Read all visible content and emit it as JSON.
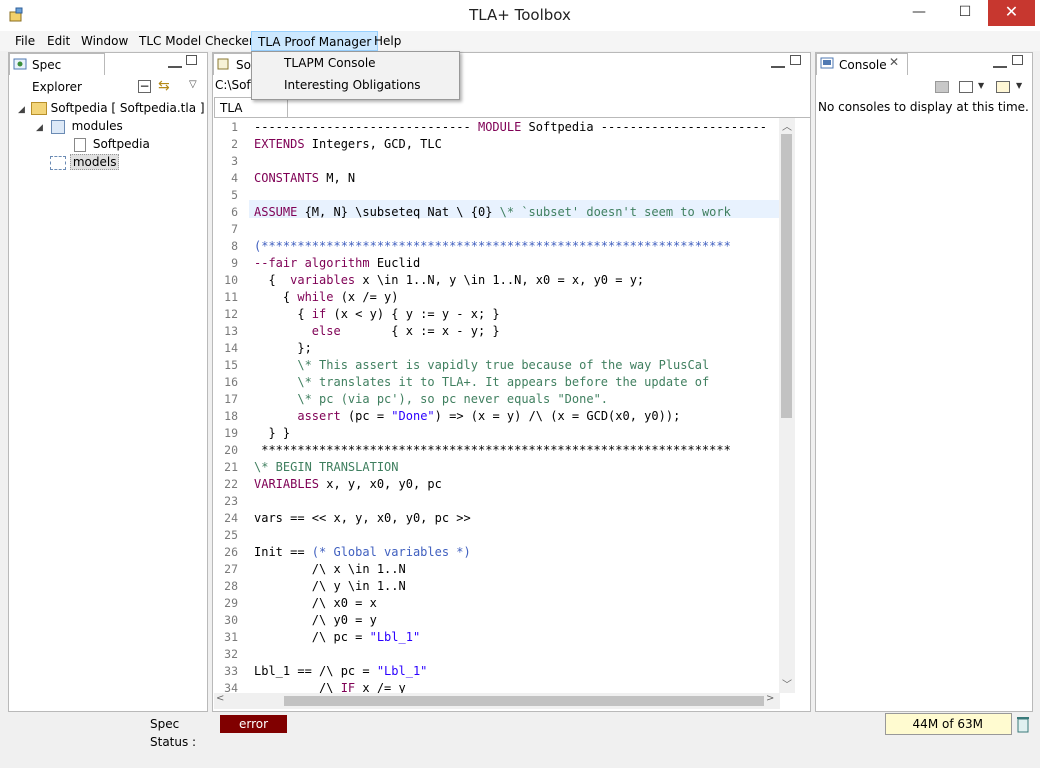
{
  "window": {
    "title": "TLA+ Toolbox",
    "minimize": "—",
    "maximize": "☐",
    "close": "✕"
  },
  "menu": [
    "File",
    "Edit",
    "Window",
    "TLC Model Checker",
    "TLA Proof Manager",
    "Help"
  ],
  "dropdown": [
    "TLAPM Console",
    "Interesting Obligations"
  ],
  "spec_explorer": {
    "tab": "Spec Explorer",
    "tree": [
      {
        "label": "Softpedia [ Softpedia.tla ]"
      },
      {
        "label": "modules"
      },
      {
        "label": "Softpedia"
      },
      {
        "label": "models"
      }
    ]
  },
  "editor": {
    "tab": "Softpedia",
    "path": "C:\\Softpedia",
    "subtab": "TLA Module",
    "lines": [
      [
        "1",
        [
          [
            "------------------------------ ",
            ""
          ],
          [
            "MODULE",
            "kw"
          ],
          [
            " Softpedia -----------------------",
            ""
          ]
        ]
      ],
      [
        "2",
        [
          [
            "EXTENDS",
            "kw"
          ],
          [
            " Integers, GCD, TLC",
            ""
          ]
        ]
      ],
      [
        "3",
        [
          [
            "",
            ""
          ]
        ]
      ],
      [
        "4",
        [
          [
            "CONSTANTS",
            "kw"
          ],
          [
            " M, N",
            ""
          ]
        ]
      ],
      [
        "5",
        [
          [
            "",
            ""
          ]
        ]
      ],
      [
        "6",
        [
          [
            "ASSUME",
            "kw"
          ],
          [
            " {M, N} \\subseteq Nat \\ {0} ",
            ""
          ],
          [
            "\\* `subset' doesn't seem to work",
            "cm"
          ]
        ]
      ],
      [
        "7",
        [
          [
            "",
            ""
          ]
        ]
      ],
      [
        "8",
        [
          [
            "(*****************************************************************",
            "bc"
          ]
        ]
      ],
      [
        "9",
        [
          [
            "--fair algorithm",
            "kw"
          ],
          [
            " Euclid",
            ""
          ]
        ]
      ],
      [
        "10",
        [
          [
            "  {  ",
            ""
          ],
          [
            "variables",
            "kw"
          ],
          [
            " x \\in 1..N, y \\in 1..N, x0 = x, y0 = y;",
            ""
          ]
        ]
      ],
      [
        "11",
        [
          [
            "    { ",
            ""
          ],
          [
            "while",
            "kw"
          ],
          [
            " (x /= y)",
            ""
          ]
        ]
      ],
      [
        "12",
        [
          [
            "      { ",
            ""
          ],
          [
            "if",
            "kw"
          ],
          [
            " (x < y) { y := y - x; }",
            ""
          ]
        ]
      ],
      [
        "13",
        [
          [
            "        ",
            ""
          ],
          [
            "else",
            "kw"
          ],
          [
            "       { x := x - y; }",
            ""
          ]
        ]
      ],
      [
        "14",
        [
          [
            "      };",
            ""
          ]
        ]
      ],
      [
        "15",
        [
          [
            "      ",
            ""
          ],
          [
            "\\* This assert is vapidly true because of the way PlusCal",
            "cm"
          ]
        ]
      ],
      [
        "16",
        [
          [
            "      ",
            ""
          ],
          [
            "\\* translates it to TLA+. It appears before the update of",
            "cm"
          ]
        ]
      ],
      [
        "17",
        [
          [
            "      ",
            ""
          ],
          [
            "\\* pc (via pc'), so pc never equals \"Done\".",
            "cm"
          ]
        ]
      ],
      [
        "18",
        [
          [
            "      ",
            ""
          ],
          [
            "assert",
            "kw"
          ],
          [
            " (pc = ",
            ""
          ],
          [
            "\"Done\"",
            "st"
          ],
          [
            ") => (x = y) /\\ (x = GCD(x0, y0));",
            ""
          ]
        ]
      ],
      [
        "19",
        [
          [
            "  } }",
            ""
          ]
        ]
      ],
      [
        "20",
        [
          [
            " *****************************************************************",
            ""
          ]
        ]
      ],
      [
        "21",
        [
          [
            "\\* BEGIN TRANSLATION",
            "cm"
          ]
        ]
      ],
      [
        "22",
        [
          [
            "VARIABLES",
            "kw"
          ],
          [
            " x, y, x0, y0, pc",
            ""
          ]
        ]
      ],
      [
        "23",
        [
          [
            "",
            ""
          ]
        ]
      ],
      [
        "24",
        [
          [
            "vars == << x, y, x0, y0, pc >>",
            ""
          ]
        ]
      ],
      [
        "25",
        [
          [
            "",
            ""
          ]
        ]
      ],
      [
        "26",
        [
          [
            "Init == ",
            ""
          ],
          [
            "(* Global variables *)",
            "bc"
          ]
        ]
      ],
      [
        "27",
        [
          [
            "        /\\ x \\in 1..N",
            ""
          ]
        ]
      ],
      [
        "28",
        [
          [
            "        /\\ y \\in 1..N",
            ""
          ]
        ]
      ],
      [
        "29",
        [
          [
            "        /\\ x0 = x",
            ""
          ]
        ]
      ],
      [
        "30",
        [
          [
            "        /\\ y0 = y",
            ""
          ]
        ]
      ],
      [
        "31",
        [
          [
            "        /\\ pc = ",
            ""
          ],
          [
            "\"Lbl_1\"",
            "st"
          ]
        ]
      ],
      [
        "32",
        [
          [
            "",
            ""
          ]
        ]
      ],
      [
        "33",
        [
          [
            "Lbl_1 == /\\ pc = ",
            ""
          ],
          [
            "\"Lbl_1\"",
            "st"
          ]
        ]
      ],
      [
        "34",
        [
          [
            "         /\\ ",
            ""
          ],
          [
            "IF",
            "kw"
          ],
          [
            " x /= y",
            ""
          ]
        ]
      ]
    ]
  },
  "console": {
    "tab": "Console",
    "message": "No consoles to display at this time."
  },
  "status": {
    "label": "Spec Status :",
    "value": "error",
    "memory": "44M of 63M",
    "error_color": "#800000"
  }
}
